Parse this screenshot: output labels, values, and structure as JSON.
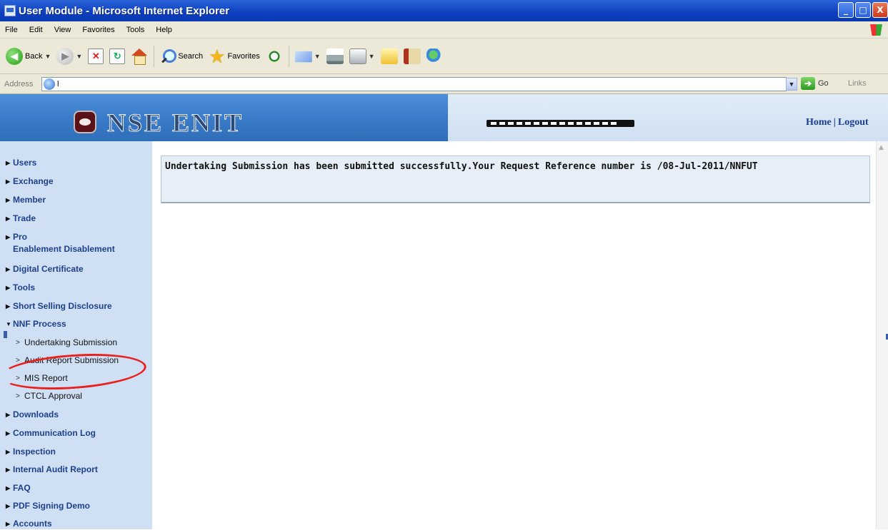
{
  "window": {
    "title": "User Module - Microsoft Internet Explorer",
    "buttons": {
      "minimize": "_",
      "maximize": "□",
      "close": "X"
    }
  },
  "menubar": [
    "File",
    "Edit",
    "View",
    "Favorites",
    "Tools",
    "Help"
  ],
  "toolbar": {
    "back_label": "Back",
    "search_label": "Search",
    "favorites_label": "Favorites"
  },
  "addressbar": {
    "label": "Address",
    "value": "l",
    "go_label": "Go",
    "links_label": "Links"
  },
  "header": {
    "logo_text": "NSE ENIT",
    "home_label": "Home",
    "separator": "|",
    "logout_label": "Logout"
  },
  "sidebar": {
    "items": [
      {
        "label": "Users",
        "expanded": false
      },
      {
        "label": "Exchange",
        "expanded": false
      },
      {
        "label": "Member",
        "expanded": false
      },
      {
        "label": "Trade",
        "expanded": false
      },
      {
        "label": "Pro",
        "label2": "Enablement Disablement",
        "expanded": false
      },
      {
        "label": "Digital Certificate",
        "expanded": false
      },
      {
        "label": "Tools",
        "expanded": false
      },
      {
        "label": "Short Selling Disclosure",
        "expanded": false
      },
      {
        "label": "NNF Process",
        "expanded": true
      },
      {
        "label": "Downloads",
        "expanded": false
      },
      {
        "label": "Communication Log",
        "expanded": false
      },
      {
        "label": "Inspection",
        "expanded": false
      },
      {
        "label": "Internal Audit Report",
        "expanded": false
      },
      {
        "label": "FAQ",
        "expanded": false
      },
      {
        "label": "PDF Signing Demo",
        "expanded": false
      },
      {
        "label": "Accounts",
        "expanded": false
      }
    ],
    "nnf_subitems": [
      {
        "label": "Undertaking Submission"
      },
      {
        "label": "Audit Report Submission"
      },
      {
        "label": "MIS Report",
        "highlighted": true
      },
      {
        "label": "CTCL Approval"
      }
    ]
  },
  "main": {
    "message": "Undertaking Submission has been submitted successfully.Your Request Reference number is /08-Jul-2011/NNFUT"
  },
  "colors": {
    "titlebar": "#0d3fbf",
    "header_blue": "#3a7cc9",
    "sidebar_bg": "#cfe0f5",
    "nav_text": "#1e3f8a",
    "highlight_ellipse": "#e8201e"
  }
}
